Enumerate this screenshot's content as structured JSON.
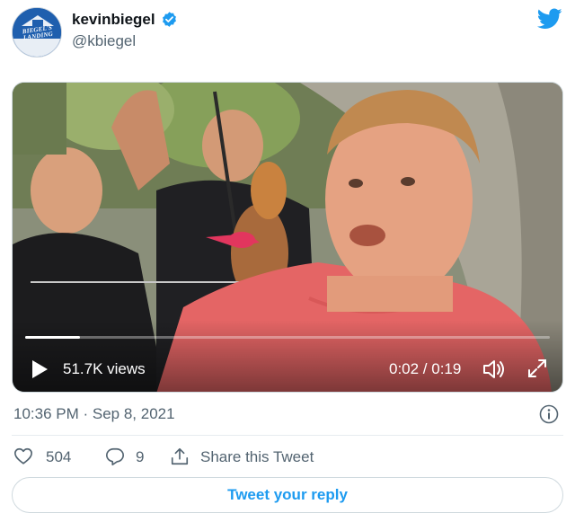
{
  "author": {
    "display_name": "kevinbiegel",
    "handle": "@kbiegel",
    "avatar_text": "BIEGEL'S LANDING",
    "verified": true
  },
  "brand": {
    "icon": "twitter-bird-icon",
    "color": "#1d9bf0"
  },
  "video": {
    "views": "51.7K views",
    "time": "0:02 / 0:19",
    "progress_fraction": 0.105,
    "icons": [
      "play-icon",
      "volume-icon",
      "fullscreen-icon"
    ]
  },
  "meta": {
    "timestamp": "10:36 PM · Sep 8, 2021",
    "info_icon": "info-icon"
  },
  "actions": {
    "likes": "504",
    "replies": "9",
    "share_label": "Share this Tweet"
  },
  "reply_button": "Tweet your reply"
}
